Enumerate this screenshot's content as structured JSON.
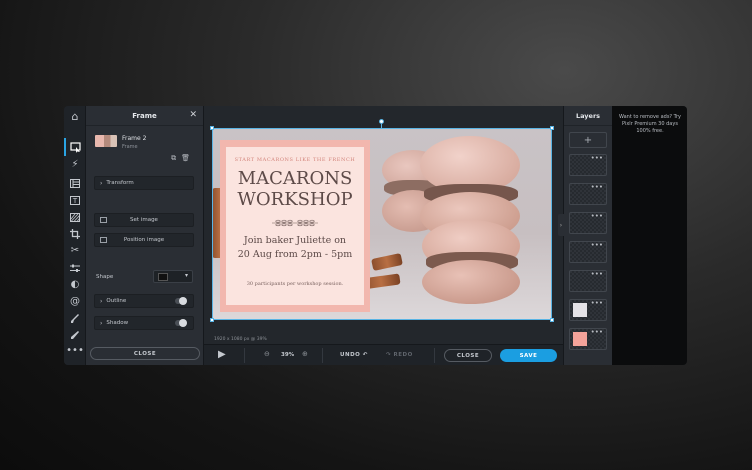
{
  "toolbar": {
    "tools": [
      "home-icon",
      "frame-icon",
      "magic-icon",
      "layout-icon",
      "text-icon",
      "texture-icon",
      "crop-icon",
      "cut-icon",
      "adjust-icon",
      "contrast-icon",
      "spiral-icon",
      "brush-icon",
      "pen-icon",
      "more-icon"
    ]
  },
  "panel": {
    "title": "Frame",
    "layer": {
      "name": "Frame 2",
      "type": "Frame"
    },
    "transform_label": "Transform",
    "set_image_label": "Set image",
    "position_image_label": "Position image",
    "shape_label": "Shape",
    "outline_label": "Outline",
    "shadow_label": "Shadow",
    "close_label": "CLOSE"
  },
  "poster": {
    "eyebrow": "START MACARONS LIKE THE FRENCH",
    "title_line1": "MACARONS",
    "title_line2": "WORKSHOP",
    "body_line1": "Join baker Juliette on",
    "body_line2": "20 Aug from 2pm - 5pm",
    "small": "30 participants per workshop session."
  },
  "canvas": {
    "dims": "1920 x 1080 px @ 39%"
  },
  "bottom_bar": {
    "zoom": "39%",
    "undo_label": "UNDO",
    "redo_label": "REDO",
    "close_label": "CLOSE",
    "save_label": "SAVE"
  },
  "layers": {
    "title": "Layers",
    "add_label": "+",
    "slot_colors": [
      "",
      "",
      "",
      "",
      "",
      "#e4e2e6",
      "#f4a39a"
    ]
  },
  "ad": {
    "text": "Want to remove ads? Try Pixlr Premium 30 days 100% free."
  },
  "colors": {
    "accent": "#1b9ee1",
    "poster_pink": "#f2b7ae",
    "poster_text": "#5d4a48"
  }
}
